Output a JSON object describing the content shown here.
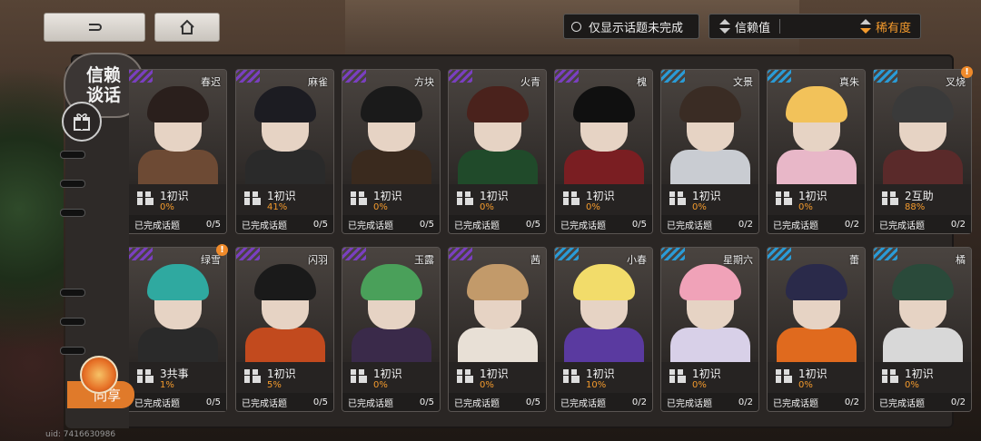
{
  "nav": {
    "back_label": "↩",
    "home_label": "⌂"
  },
  "filter": {
    "label": "仅显示话题未完成"
  },
  "sort": {
    "trust_label": "信赖值",
    "rarity_label": "稀有度"
  },
  "sidebar": {
    "title": "信赖谈话",
    "share_label": "同享"
  },
  "uid_text": "uid: 7416630986",
  "footer_label": "已完成话题",
  "colors": {
    "accent": "#f39a2d",
    "rarity_purple": "#7a3fc0",
    "rarity_blue": "#2a9bd6"
  },
  "cards": [
    {
      "name": "春迟",
      "level": "1初识",
      "pct": "0%",
      "progress": "0/5",
      "rarity": "purple",
      "hair": "#2a1f1c",
      "body": "#6d4a34",
      "alert": false
    },
    {
      "name": "麻雀",
      "level": "1初识",
      "pct": "41%",
      "progress": "0/5",
      "rarity": "purple",
      "hair": "#1c1c22",
      "body": "#2a2a2a",
      "alert": false
    },
    {
      "name": "方块",
      "level": "1初识",
      "pct": "0%",
      "progress": "0/5",
      "rarity": "purple",
      "hair": "#1a1a1a",
      "body": "#3a2a1e",
      "alert": false
    },
    {
      "name": "火青",
      "level": "1初识",
      "pct": "0%",
      "progress": "0/5",
      "rarity": "purple",
      "hair": "#4a221c",
      "body": "#204a2a",
      "alert": false
    },
    {
      "name": "槐",
      "level": "1初识",
      "pct": "0%",
      "progress": "0/5",
      "rarity": "purple",
      "hair": "#101010",
      "body": "#7a1e22",
      "alert": false
    },
    {
      "name": "文景",
      "level": "1初识",
      "pct": "0%",
      "progress": "0/2",
      "rarity": "blue",
      "hair": "#3a2c24",
      "body": "#c9ccd2",
      "alert": false
    },
    {
      "name": "真朱",
      "level": "1初识",
      "pct": "0%",
      "progress": "0/2",
      "rarity": "blue",
      "hair": "#f2c25a",
      "body": "#e8b7c8",
      "alert": false
    },
    {
      "name": "叉烧",
      "level": "2互助",
      "pct": "88%",
      "progress": "0/2",
      "rarity": "blue",
      "hair": "#3a3a3a",
      "body": "#5a2a2a",
      "alert": true
    },
    {
      "name": "绿雪",
      "level": "3共事",
      "pct": "1%",
      "progress": "0/5",
      "rarity": "purple",
      "hair": "#2fa9a0",
      "body": "#2a2a2a",
      "alert": true
    },
    {
      "name": "闪羽",
      "level": "1初识",
      "pct": "5%",
      "progress": "0/5",
      "rarity": "purple",
      "hair": "#1a1a1a",
      "body": "#c24a1e",
      "alert": false
    },
    {
      "name": "玉露",
      "level": "1初识",
      "pct": "0%",
      "progress": "0/5",
      "rarity": "purple",
      "hair": "#4aa05a",
      "body": "#3a2a4a",
      "alert": false
    },
    {
      "name": "茜",
      "level": "1初识",
      "pct": "0%",
      "progress": "0/5",
      "rarity": "purple",
      "hair": "#c29a6a",
      "body": "#e8e0d6",
      "alert": false
    },
    {
      "name": "小春",
      "level": "1初识",
      "pct": "10%",
      "progress": "0/2",
      "rarity": "blue",
      "hair": "#f2dc6a",
      "body": "#5a3aa0",
      "alert": false
    },
    {
      "name": "星期六",
      "level": "1初识",
      "pct": "0%",
      "progress": "0/2",
      "rarity": "blue",
      "hair": "#f0a2b8",
      "body": "#d8d0e8",
      "alert": false
    },
    {
      "name": "蕾",
      "level": "1初识",
      "pct": "0%",
      "progress": "0/2",
      "rarity": "blue",
      "hair": "#2a2a4a",
      "body": "#e06a1e",
      "alert": false
    },
    {
      "name": "橘",
      "level": "1初识",
      "pct": "0%",
      "progress": "0/2",
      "rarity": "blue",
      "hair": "#2a4a3a",
      "body": "#d8d8d8",
      "alert": false
    }
  ]
}
